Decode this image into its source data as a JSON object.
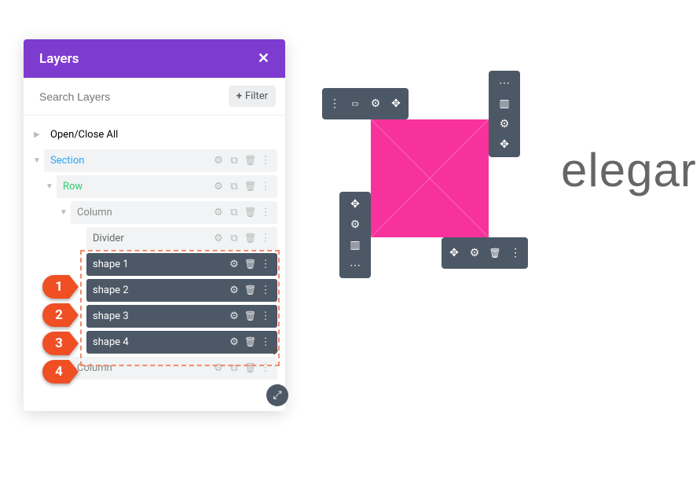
{
  "panel": {
    "title": "Layers",
    "search_placeholder": "Search Layers",
    "filter_label": "Filter",
    "open_close_all": "Open/Close All"
  },
  "tree": {
    "section": "Section",
    "row": "Row",
    "column": "Column",
    "divider": "Divider",
    "shapes": [
      "shape 1",
      "shape 2",
      "shape 3",
      "shape 4"
    ]
  },
  "badges": [
    "1",
    "2",
    "3",
    "4"
  ],
  "colors": {
    "accent": "#7e3bd0",
    "pink": "#f8329c",
    "toolbar": "#4c5866",
    "badge": "#f04e23"
  },
  "canvas_text": "elegar"
}
